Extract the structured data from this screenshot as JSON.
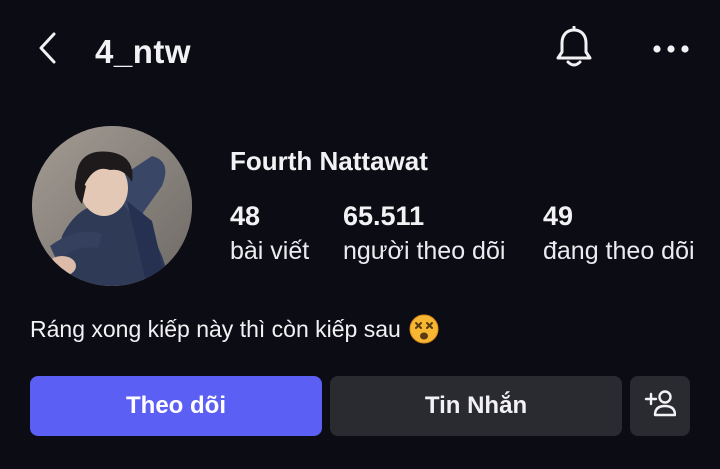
{
  "header": {
    "username": "4_ntw",
    "back_icon": "chevron-left-icon",
    "bell_icon": "bell-icon",
    "more_icon": "more-horizontal-icon"
  },
  "profile": {
    "display_name": "Fourth Nattawat",
    "avatar": "profile-photo",
    "stats": {
      "posts": {
        "value": "48",
        "label": "bài viết"
      },
      "followers": {
        "value": "65.511",
        "label": "người theo dõi"
      },
      "following": {
        "value": "49",
        "label": "đang theo dõi"
      }
    },
    "bio": "Ráng xong kiếp này thì còn kiếp sau",
    "bio_emoji": "dizzy-face-emoji"
  },
  "actions": {
    "follow_label": "Theo dõi",
    "message_label": "Tin Nhắn",
    "suggest_icon": "add-person-icon"
  },
  "colors": {
    "background": "#0c0c14",
    "follow_button": "#5b5ff3",
    "secondary_button": "#2a2a31",
    "text": "#f2f2f5"
  }
}
